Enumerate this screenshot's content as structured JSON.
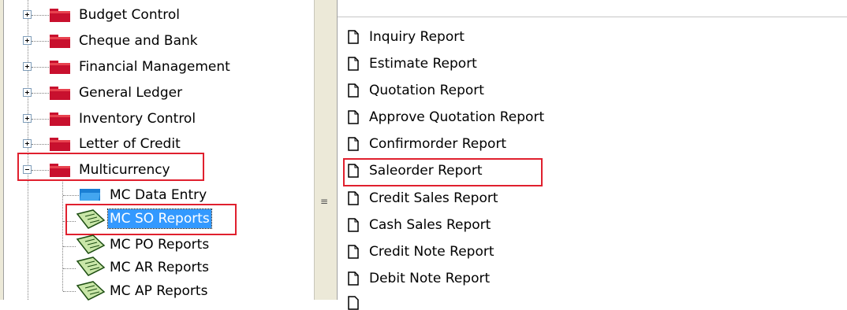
{
  "tree": {
    "items": [
      {
        "label": "Budget Control"
      },
      {
        "label": "Cheque and Bank"
      },
      {
        "label": "Financial Management"
      },
      {
        "label": "General Ledger"
      },
      {
        "label": "Inventory Control"
      },
      {
        "label": "Letter of Credit"
      },
      {
        "label": "Multicurrency"
      }
    ],
    "children": [
      {
        "label": "MC Data Entry"
      },
      {
        "label": "MC SO Reports"
      },
      {
        "label": "MC PO Reports"
      },
      {
        "label": "MC AR Reports"
      },
      {
        "label": "MC AP Reports"
      }
    ]
  },
  "reports": {
    "items": [
      {
        "label": "Inquiry Report"
      },
      {
        "label": "Estimate Report"
      },
      {
        "label": "Quotation Report"
      },
      {
        "label": "Approve Quotation Report"
      },
      {
        "label": "Confirmorder Report"
      },
      {
        "label": "Saleorder Report"
      },
      {
        "label": "Credit Sales Report"
      },
      {
        "label": "Cash Sales Report"
      },
      {
        "label": "Credit Note Report"
      },
      {
        "label": "Debit Note Report"
      }
    ]
  },
  "splitter": {
    "grip": "≡"
  },
  "colors": {
    "highlight": "#e0202e",
    "selection": "#3399ff",
    "folder": "#c8102e"
  }
}
